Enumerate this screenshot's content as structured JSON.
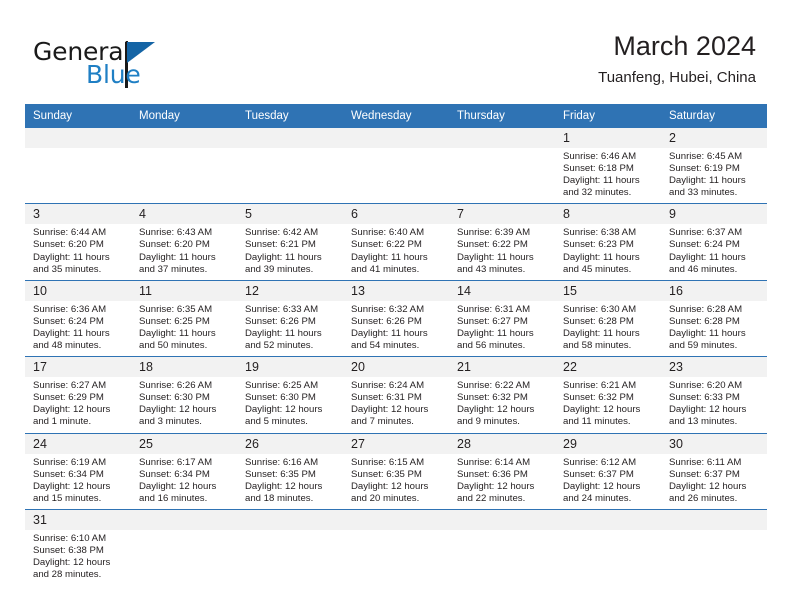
{
  "brand": {
    "name_part1": "General",
    "name_part2": "Blue",
    "logo_icon": "triangle-logo-icon",
    "color_primary": "#2f73b4",
    "color_blue_text": "#1f7fc4"
  },
  "header": {
    "title": "March 2024",
    "subtitle": "Tuanfeng, Hubei, China"
  },
  "calendar": {
    "weekday_headers": [
      "Sunday",
      "Monday",
      "Tuesday",
      "Wednesday",
      "Thursday",
      "Friday",
      "Saturday"
    ],
    "labels": {
      "sunrise": "Sunrise:",
      "sunset": "Sunset:",
      "daylight": "Daylight:"
    },
    "weeks": [
      [
        {
          "day": "",
          "empty": true
        },
        {
          "day": "",
          "empty": true
        },
        {
          "day": "",
          "empty": true
        },
        {
          "day": "",
          "empty": true
        },
        {
          "day": "",
          "empty": true
        },
        {
          "day": "1",
          "sunrise": "Sunrise: 6:46 AM",
          "sunset": "Sunset: 6:18 PM",
          "daylight_l1": "Daylight: 11 hours",
          "daylight_l2": "and 32 minutes."
        },
        {
          "day": "2",
          "sunrise": "Sunrise: 6:45 AM",
          "sunset": "Sunset: 6:19 PM",
          "daylight_l1": "Daylight: 11 hours",
          "daylight_l2": "and 33 minutes."
        }
      ],
      [
        {
          "day": "3",
          "sunrise": "Sunrise: 6:44 AM",
          "sunset": "Sunset: 6:20 PM",
          "daylight_l1": "Daylight: 11 hours",
          "daylight_l2": "and 35 minutes."
        },
        {
          "day": "4",
          "sunrise": "Sunrise: 6:43 AM",
          "sunset": "Sunset: 6:20 PM",
          "daylight_l1": "Daylight: 11 hours",
          "daylight_l2": "and 37 minutes."
        },
        {
          "day": "5",
          "sunrise": "Sunrise: 6:42 AM",
          "sunset": "Sunset: 6:21 PM",
          "daylight_l1": "Daylight: 11 hours",
          "daylight_l2": "and 39 minutes."
        },
        {
          "day": "6",
          "sunrise": "Sunrise: 6:40 AM",
          "sunset": "Sunset: 6:22 PM",
          "daylight_l1": "Daylight: 11 hours",
          "daylight_l2": "and 41 minutes."
        },
        {
          "day": "7",
          "sunrise": "Sunrise: 6:39 AM",
          "sunset": "Sunset: 6:22 PM",
          "daylight_l1": "Daylight: 11 hours",
          "daylight_l2": "and 43 minutes."
        },
        {
          "day": "8",
          "sunrise": "Sunrise: 6:38 AM",
          "sunset": "Sunset: 6:23 PM",
          "daylight_l1": "Daylight: 11 hours",
          "daylight_l2": "and 45 minutes."
        },
        {
          "day": "9",
          "sunrise": "Sunrise: 6:37 AM",
          "sunset": "Sunset: 6:24 PM",
          "daylight_l1": "Daylight: 11 hours",
          "daylight_l2": "and 46 minutes."
        }
      ],
      [
        {
          "day": "10",
          "sunrise": "Sunrise: 6:36 AM",
          "sunset": "Sunset: 6:24 PM",
          "daylight_l1": "Daylight: 11 hours",
          "daylight_l2": "and 48 minutes."
        },
        {
          "day": "11",
          "sunrise": "Sunrise: 6:35 AM",
          "sunset": "Sunset: 6:25 PM",
          "daylight_l1": "Daylight: 11 hours",
          "daylight_l2": "and 50 minutes."
        },
        {
          "day": "12",
          "sunrise": "Sunrise: 6:33 AM",
          "sunset": "Sunset: 6:26 PM",
          "daylight_l1": "Daylight: 11 hours",
          "daylight_l2": "and 52 minutes."
        },
        {
          "day": "13",
          "sunrise": "Sunrise: 6:32 AM",
          "sunset": "Sunset: 6:26 PM",
          "daylight_l1": "Daylight: 11 hours",
          "daylight_l2": "and 54 minutes."
        },
        {
          "day": "14",
          "sunrise": "Sunrise: 6:31 AM",
          "sunset": "Sunset: 6:27 PM",
          "daylight_l1": "Daylight: 11 hours",
          "daylight_l2": "and 56 minutes."
        },
        {
          "day": "15",
          "sunrise": "Sunrise: 6:30 AM",
          "sunset": "Sunset: 6:28 PM",
          "daylight_l1": "Daylight: 11 hours",
          "daylight_l2": "and 58 minutes."
        },
        {
          "day": "16",
          "sunrise": "Sunrise: 6:28 AM",
          "sunset": "Sunset: 6:28 PM",
          "daylight_l1": "Daylight: 11 hours",
          "daylight_l2": "and 59 minutes."
        }
      ],
      [
        {
          "day": "17",
          "sunrise": "Sunrise: 6:27 AM",
          "sunset": "Sunset: 6:29 PM",
          "daylight_l1": "Daylight: 12 hours",
          "daylight_l2": "and 1 minute."
        },
        {
          "day": "18",
          "sunrise": "Sunrise: 6:26 AM",
          "sunset": "Sunset: 6:30 PM",
          "daylight_l1": "Daylight: 12 hours",
          "daylight_l2": "and 3 minutes."
        },
        {
          "day": "19",
          "sunrise": "Sunrise: 6:25 AM",
          "sunset": "Sunset: 6:30 PM",
          "daylight_l1": "Daylight: 12 hours",
          "daylight_l2": "and 5 minutes."
        },
        {
          "day": "20",
          "sunrise": "Sunrise: 6:24 AM",
          "sunset": "Sunset: 6:31 PM",
          "daylight_l1": "Daylight: 12 hours",
          "daylight_l2": "and 7 minutes."
        },
        {
          "day": "21",
          "sunrise": "Sunrise: 6:22 AM",
          "sunset": "Sunset: 6:32 PM",
          "daylight_l1": "Daylight: 12 hours",
          "daylight_l2": "and 9 minutes."
        },
        {
          "day": "22",
          "sunrise": "Sunrise: 6:21 AM",
          "sunset": "Sunset: 6:32 PM",
          "daylight_l1": "Daylight: 12 hours",
          "daylight_l2": "and 11 minutes."
        },
        {
          "day": "23",
          "sunrise": "Sunrise: 6:20 AM",
          "sunset": "Sunset: 6:33 PM",
          "daylight_l1": "Daylight: 12 hours",
          "daylight_l2": "and 13 minutes."
        }
      ],
      [
        {
          "day": "24",
          "sunrise": "Sunrise: 6:19 AM",
          "sunset": "Sunset: 6:34 PM",
          "daylight_l1": "Daylight: 12 hours",
          "daylight_l2": "and 15 minutes."
        },
        {
          "day": "25",
          "sunrise": "Sunrise: 6:17 AM",
          "sunset": "Sunset: 6:34 PM",
          "daylight_l1": "Daylight: 12 hours",
          "daylight_l2": "and 16 minutes."
        },
        {
          "day": "26",
          "sunrise": "Sunrise: 6:16 AM",
          "sunset": "Sunset: 6:35 PM",
          "daylight_l1": "Daylight: 12 hours",
          "daylight_l2": "and 18 minutes."
        },
        {
          "day": "27",
          "sunrise": "Sunrise: 6:15 AM",
          "sunset": "Sunset: 6:35 PM",
          "daylight_l1": "Daylight: 12 hours",
          "daylight_l2": "and 20 minutes."
        },
        {
          "day": "28",
          "sunrise": "Sunrise: 6:14 AM",
          "sunset": "Sunset: 6:36 PM",
          "daylight_l1": "Daylight: 12 hours",
          "daylight_l2": "and 22 minutes."
        },
        {
          "day": "29",
          "sunrise": "Sunrise: 6:12 AM",
          "sunset": "Sunset: 6:37 PM",
          "daylight_l1": "Daylight: 12 hours",
          "daylight_l2": "and 24 minutes."
        },
        {
          "day": "30",
          "sunrise": "Sunrise: 6:11 AM",
          "sunset": "Sunset: 6:37 PM",
          "daylight_l1": "Daylight: 12 hours",
          "daylight_l2": "and 26 minutes."
        }
      ],
      [
        {
          "day": "31",
          "sunrise": "Sunrise: 6:10 AM",
          "sunset": "Sunset: 6:38 PM",
          "daylight_l1": "Daylight: 12 hours",
          "daylight_l2": "and 28 minutes."
        },
        {
          "day": "",
          "empty": true
        },
        {
          "day": "",
          "empty": true
        },
        {
          "day": "",
          "empty": true
        },
        {
          "day": "",
          "empty": true
        },
        {
          "day": "",
          "empty": true
        },
        {
          "day": "",
          "empty": true
        }
      ]
    ]
  }
}
